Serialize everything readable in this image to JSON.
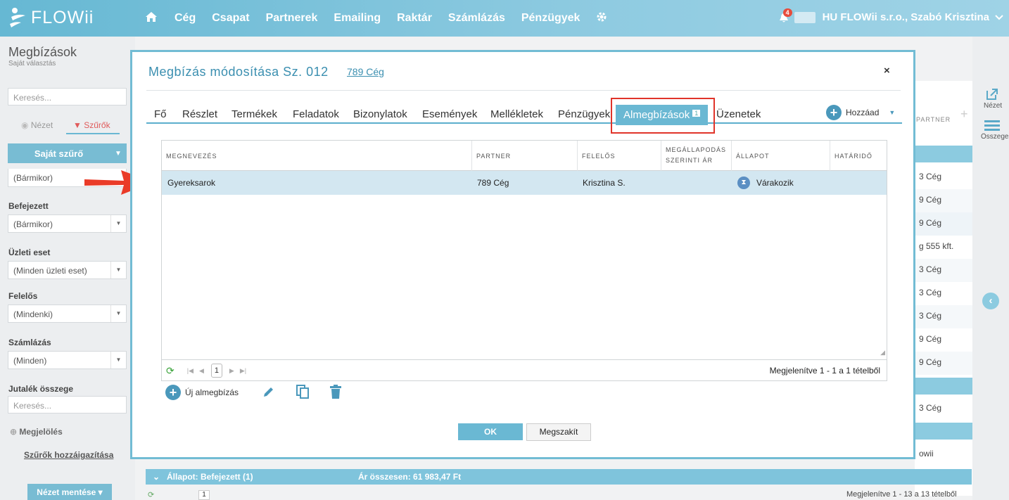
{
  "app": {
    "logo": "FLOWii"
  },
  "nav": {
    "items": [
      "Cég",
      "Csapat",
      "Partnerek",
      "Emailing",
      "Raktár",
      "Számlázás",
      "Pénzügyek"
    ]
  },
  "user": {
    "notifications": "4",
    "company": "HU FLOWii s.r.o., Szabó Krisztina"
  },
  "sidebar": {
    "title": "Megbízások",
    "subtitle": "Saját választás",
    "search_placeholder": "Keresés...",
    "tab_view": "Nézet",
    "tab_filters": "Szűrők",
    "own_filter": "Saját szűrő",
    "first_select": "(Bármikor)",
    "filters": [
      {
        "label": "Befejezett",
        "value": "(Bármikor)"
      },
      {
        "label": "Üzleti eset",
        "value": "(Minden üzleti eset)"
      },
      {
        "label": "Felelős",
        "value": "(Mindenki)"
      },
      {
        "label": "Számlázás",
        "value": "(Minden)"
      }
    ],
    "commission_label": "Jutalék összege",
    "commission_placeholder": "Keresés...",
    "marking": "Megjelölés",
    "assign_filters": "Szűrők hozzáigazítása",
    "save_view": "Nézet mentése"
  },
  "background": {
    "column_header": "PARTNER",
    "cells": [
      "3 Cég",
      "9 Cég",
      "9 Cég",
      "g 555 kft.",
      "3 Cég",
      "3 Cég",
      "3 Cég",
      "9 Cég",
      "9 Cég",
      "3 Cég",
      "owii"
    ],
    "right_view": "Nézet",
    "right_summary": "Összegez",
    "status_group": "Állapot: Befejezett (1)",
    "price_total": "Ár összesen: 61 983,47 Ft",
    "bottom_status": "Megjelenítve 1 - 13 a 13 tételből"
  },
  "modal": {
    "title": "Megbízás módosítása Sz. 012",
    "partner_link": "789 Cég",
    "close": "×",
    "tabs": [
      "Fő",
      "Részlet",
      "Termékek",
      "Feladatok",
      "Bizonylatok",
      "Események",
      "Mellékletek",
      "Pénzügyek"
    ],
    "active_tab": "Almegbízások",
    "active_tab_count": "1",
    "last_tab": "Üzenetek",
    "add_label": "Hozzáad",
    "grid": {
      "columns": [
        "Megnevezés",
        "Partner",
        "Felelős",
        "Megállapodás szerinti ár",
        "Állapot",
        "Határidő"
      ],
      "rows": [
        {
          "name": "Gyereksarok",
          "partner": "789 Cég",
          "owner": "Krisztina S.",
          "price": "",
          "status": "Várakozik",
          "deadline": ""
        }
      ],
      "page": "1",
      "status": "Megjelenítve 1 - 1 a 1 tételből"
    },
    "new_sub": "Új almegbízás",
    "ok": "OK",
    "cancel": "Megszakít"
  },
  "colors": {
    "accent": "#6ab8d3",
    "highlight": "#e0342a",
    "row_selected": "#d3e7f1"
  }
}
